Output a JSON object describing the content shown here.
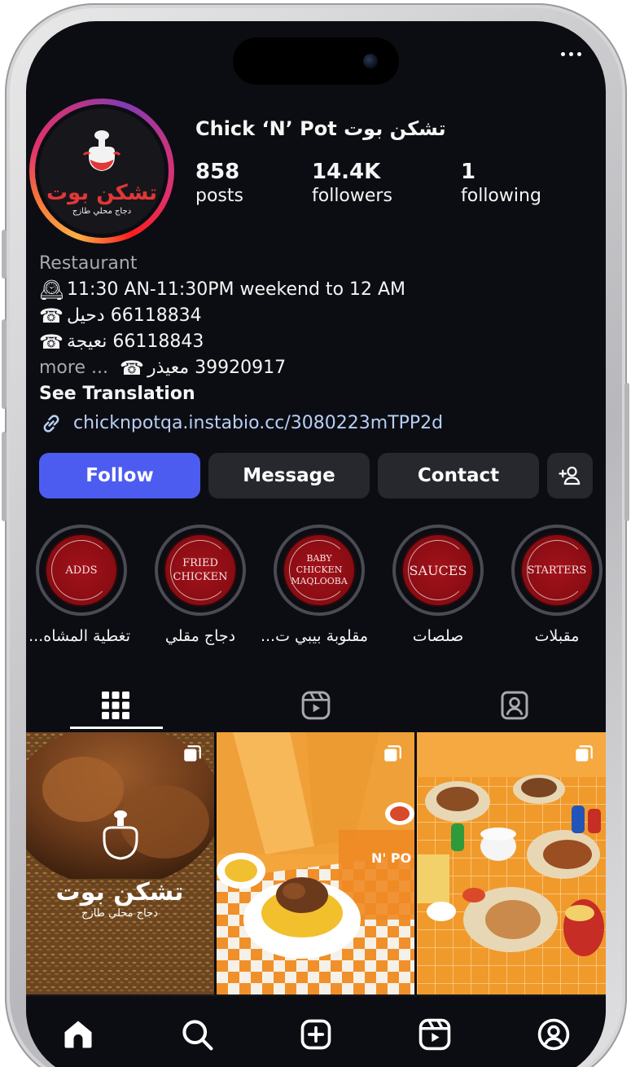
{
  "profile": {
    "name": "Chick ‘N’ Pot تشكن بوت",
    "logo_title": "تشكن بوت",
    "logo_subtitle": "دجاج محلي طازج",
    "stats": [
      {
        "value": "858",
        "label": "posts"
      },
      {
        "value": "14.4K",
        "label": "followers"
      },
      {
        "value": "1",
        "label": "following"
      }
    ]
  },
  "bio": {
    "category": "Restaurant",
    "hours": "11:30 AN-11:30PM weekend to 12 AM",
    "phones": [
      "66118834 دحيل",
      "66118843 نعيجة",
      "39920917 معيذر"
    ],
    "more": "more ...",
    "see_translation": "See Translation",
    "link": "chicknpotqa.instabio.cc/3080223mTPP2d"
  },
  "buttons": {
    "follow": "Follow",
    "message": "Message",
    "contact": "Contact"
  },
  "highlights": [
    {
      "cover": "ADDS",
      "label": "تغطية المشاه..."
    },
    {
      "cover": "FRIED CHICKEN",
      "label": "دجاج مقلي"
    },
    {
      "cover": "BABY CHICKEN MAQLOOBA",
      "label": "مقلوبة بيبي ت..."
    },
    {
      "cover": "SAUCES",
      "label": "صلصات"
    },
    {
      "cover": "STARTERS",
      "label": "مقبلات"
    }
  ],
  "posts": [
    {
      "logo_title": "تشكن بوت",
      "logo_subtitle": "دجاج محلي طازج"
    },
    {
      "sign_text": "N' PO"
    },
    {
      "sign_text": ""
    }
  ],
  "colors": {
    "follow": "#4d5cf0",
    "screen_bg": "#0c0d13",
    "highlight_red": "#a3121a",
    "link": "#b8cff5"
  },
  "icons": {
    "menu": "more-dots-icon",
    "link": "link-chain-icon",
    "add_person": "add-person-icon",
    "tabs": [
      "grid-icon",
      "reels-icon",
      "tagged-icon"
    ],
    "nav": [
      "home-icon",
      "search-icon",
      "create-icon",
      "reels-icon",
      "profile-icon"
    ]
  }
}
